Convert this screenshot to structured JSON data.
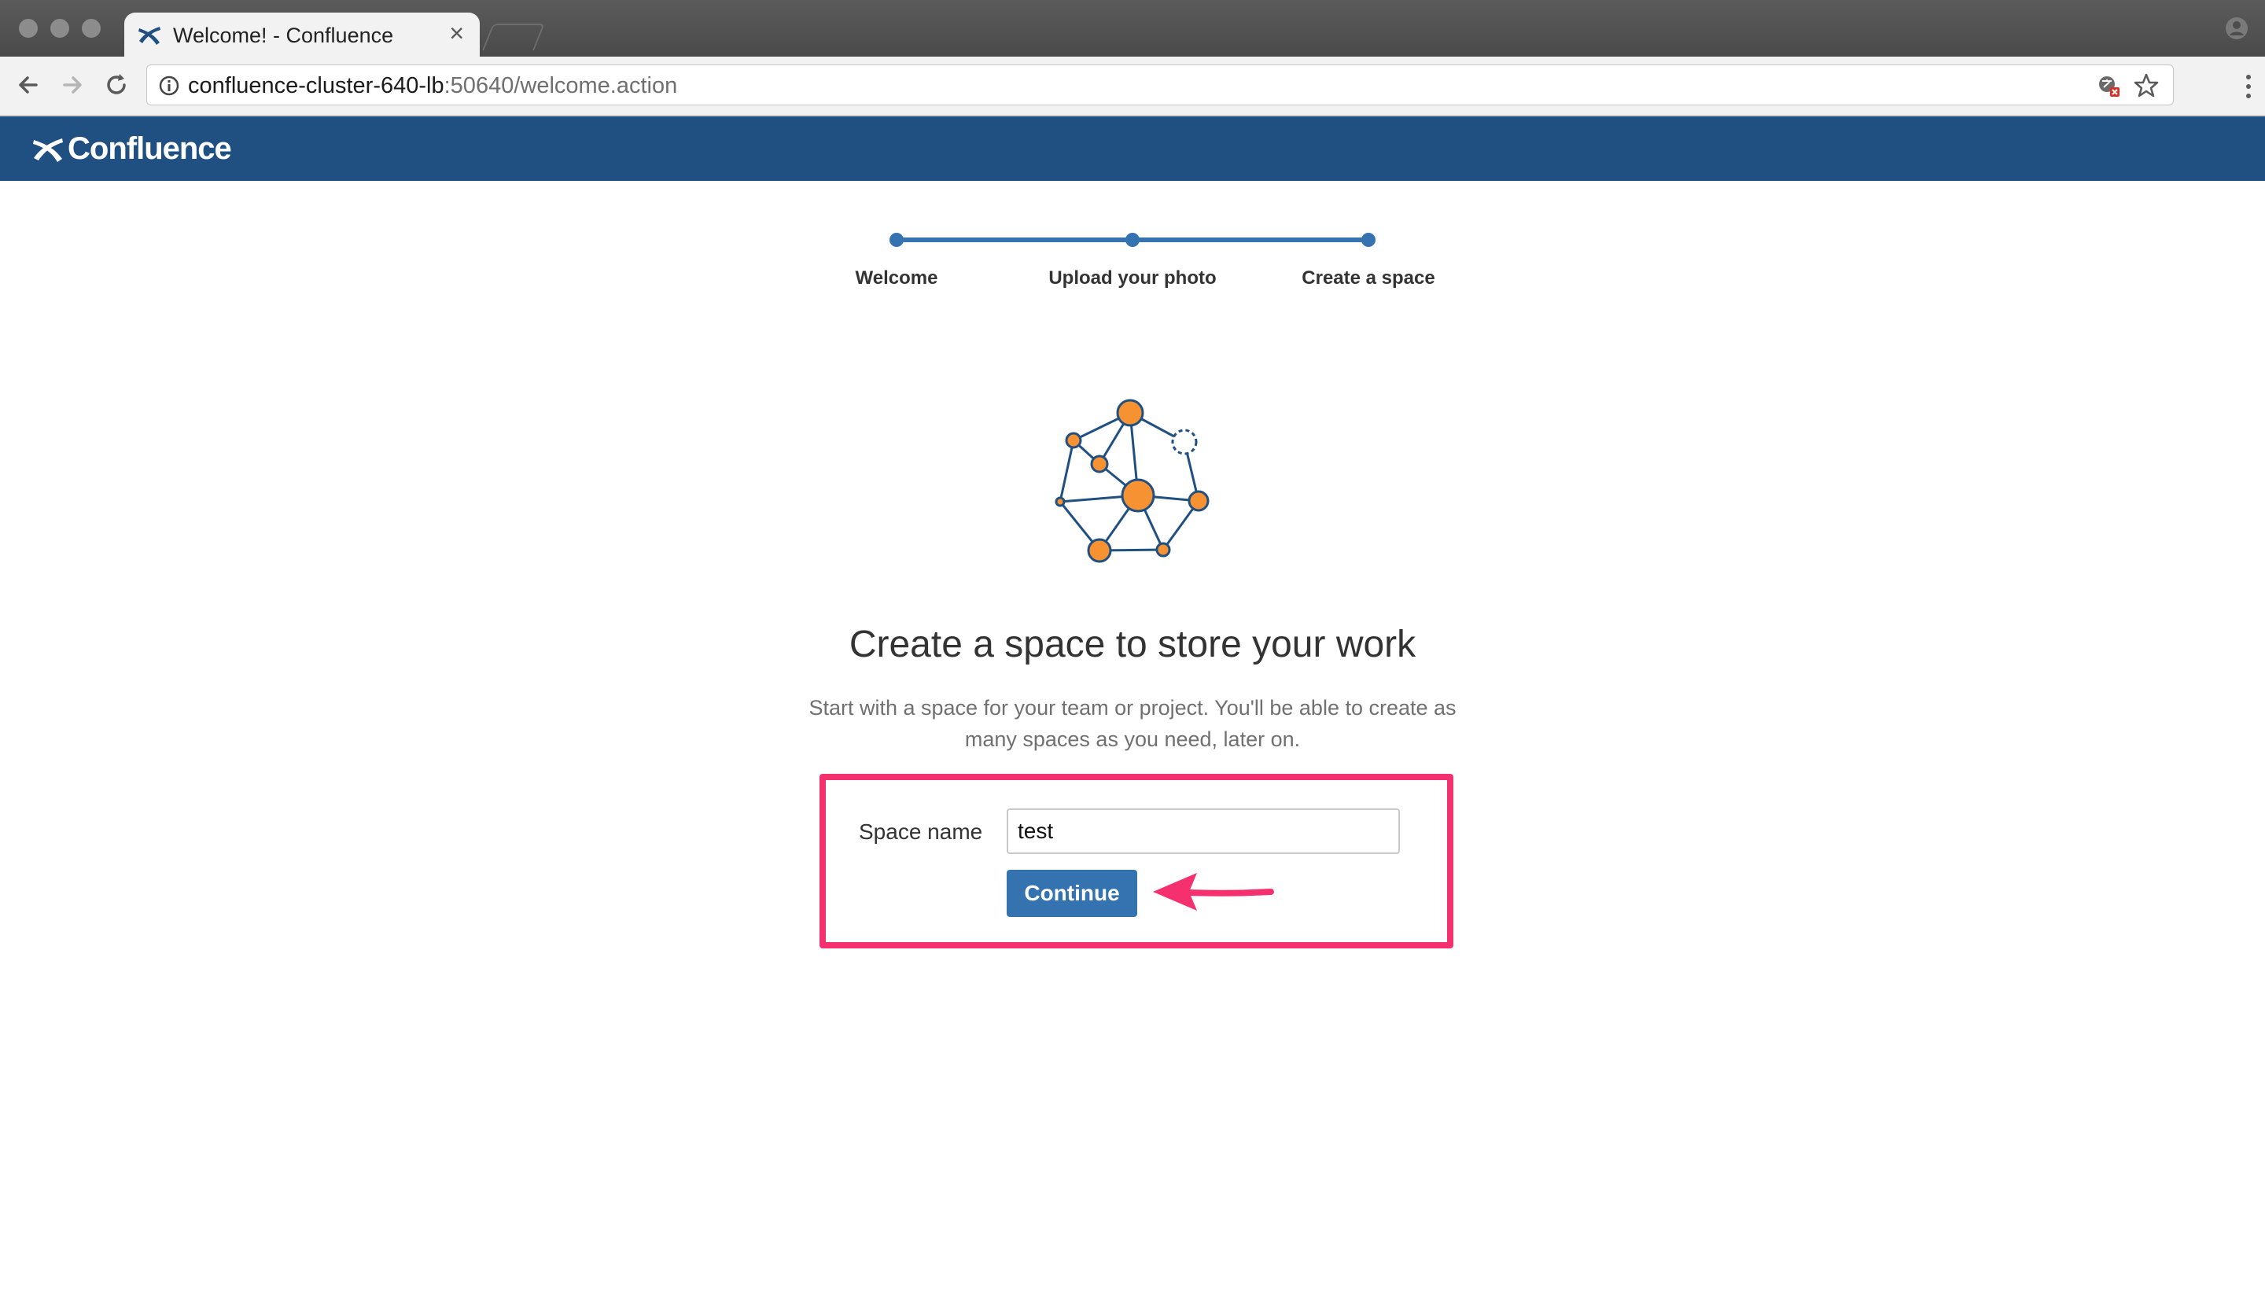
{
  "browser": {
    "tab_title": "Welcome! - Confluence",
    "tab_close": "×",
    "url_host": "confluence-cluster-640-lb",
    "url_rest": ":50640/welcome.action"
  },
  "app": {
    "logo_text": "Confluence",
    "header_color": "#205081"
  },
  "progress": {
    "steps": [
      {
        "label": "Welcome",
        "state": "complete"
      },
      {
        "label": "Upload your photo",
        "state": "complete"
      },
      {
        "label": "Create a space",
        "state": "current"
      }
    ],
    "color": "#3572b0"
  },
  "main": {
    "illustration_icon": "network-nodes-icon",
    "heading": "Create a space to store your work",
    "subtext": "Start with a space for your team or project. You'll be able to create as many spaces as you need, later on.",
    "form": {
      "space_name_label": "Space name",
      "space_name_value": "test",
      "continue_label": "Continue"
    },
    "annotation": {
      "highlight_color": "#f5306e",
      "arrow_icon": "pink-arrow-icon"
    }
  },
  "icons": {
    "back": "arrow-left-icon",
    "forward": "arrow-right-icon",
    "reload": "reload-icon",
    "info": "info-icon",
    "translate": "translate-icon",
    "bookmark": "star-icon",
    "menu": "kebab-menu-icon",
    "profile": "profile-icon"
  }
}
